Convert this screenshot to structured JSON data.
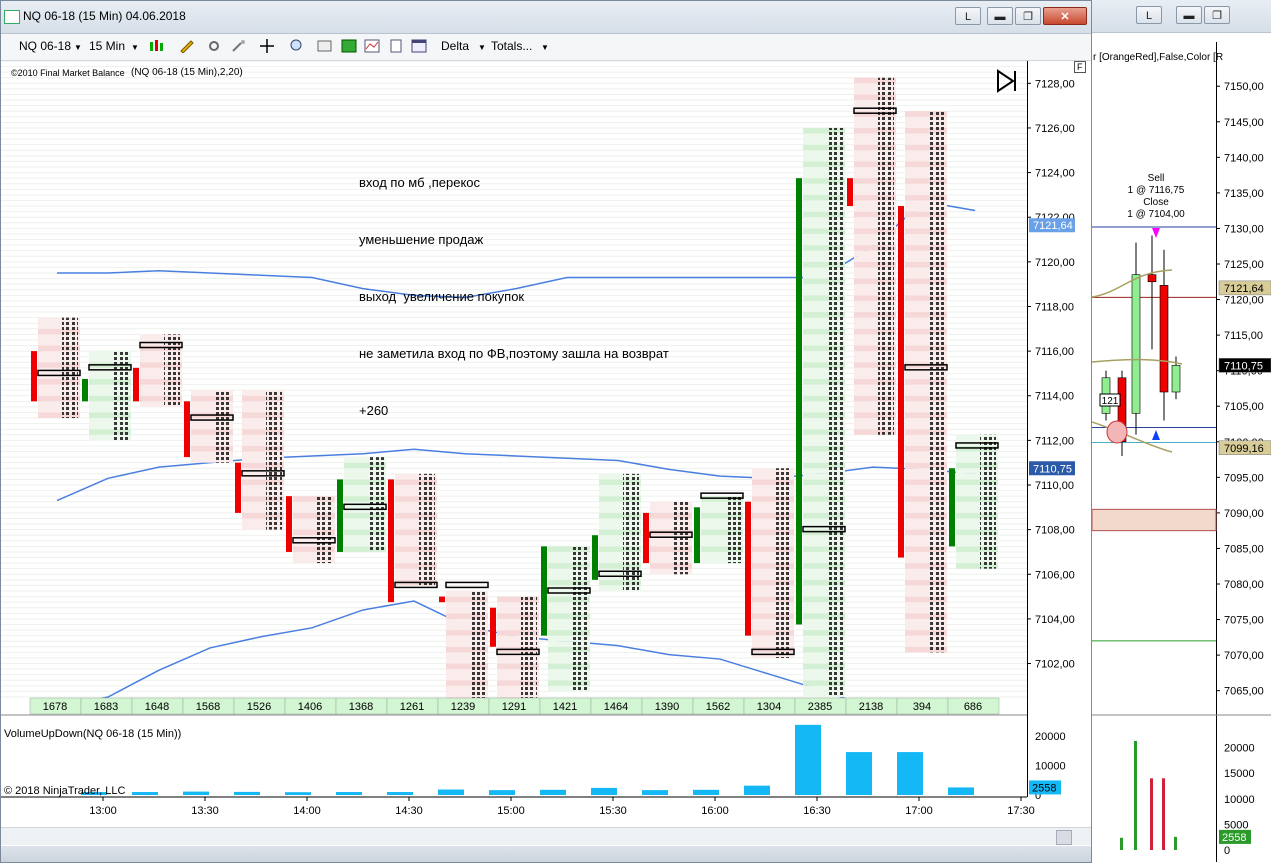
{
  "window": {
    "title": "NQ 06-18 (15 Min)  04.06.2018",
    "buttons": [
      "L",
      "▬",
      "❐",
      "✕"
    ]
  },
  "toolbar": {
    "instrument": "NQ 06-18",
    "interval": "15 Min",
    "indicator_dropdown_1": "Delta",
    "indicator_dropdown_2": "Totals..."
  },
  "indicator_label": "©2010 Final Market Balance",
  "indicator_params": "(NQ 06-18 (15 Min),2,20)",
  "annotation_lines": [
    "вход по мб ,перекос",
    "уменьшение продаж",
    "выход  увеличение покупок",
    "не заметила вход по ФВ,поэтому зашла на возврат",
    "+260"
  ],
  "panel_flag": "F",
  "sub_panel_label": "VolumeUpDown(NQ 06-18 (15 Min))",
  "copyright": "© 2018 NinjaTrader, LLC",
  "colors": {
    "up": "#008000",
    "down": "#ee0000",
    "band": "#4a7fe0",
    "volume": "#14b8f5",
    "price_tag": "#4a86d8"
  },
  "chart_data": [
    {
      "type": "candlestick",
      "title": "NQ 06-18 (15 Min)",
      "time_labels": [
        "13:00",
        "13:30",
        "14:00",
        "14:30",
        "15:00",
        "15:30",
        "16:00",
        "16:30",
        "17:00",
        "17:30"
      ],
      "y_ticks": [
        "7128,00",
        "7126,00",
        "7124,00",
        "7122,00",
        "7120,00",
        "7118,00",
        "7116,00",
        "7114,00",
        "7112,00",
        "7110,00",
        "7108,00",
        "7106,00",
        "7104,00",
        "7102,00"
      ],
      "ylim": [
        7100.5,
        7129.0
      ],
      "current_price": "7110,75",
      "price_tags": [
        "7121,64",
        "7110,75"
      ],
      "bars": [
        {
          "time": "12:45",
          "open": 7116.0,
          "close": 7113.75,
          "low": 7113.0,
          "high": 7117.5,
          "poc": 7115.0,
          "total": "1678"
        },
        {
          "time": "13:00",
          "open": 7113.75,
          "close": 7114.75,
          "low": 7112.0,
          "high": 7116.0,
          "poc": 7115.25,
          "total": "1683"
        },
        {
          "time": "13:15",
          "open": 7115.25,
          "close": 7113.75,
          "low": 7113.5,
          "high": 7116.75,
          "poc": 7116.25,
          "total": "1648"
        },
        {
          "time": "13:30",
          "open": 7113.75,
          "close": 7111.25,
          "low": 7111.0,
          "high": 7114.25,
          "poc": 7113.0,
          "total": "1568"
        },
        {
          "time": "13:45",
          "open": 7111.0,
          "close": 7108.75,
          "low": 7108.0,
          "high": 7114.25,
          "poc": 7110.5,
          "total": "1526"
        },
        {
          "time": "14:00",
          "open": 7109.5,
          "close": 7107.0,
          "low": 7106.5,
          "high": 7109.5,
          "poc": 7107.5,
          "total": "1406"
        },
        {
          "time": "14:15",
          "open": 7107.0,
          "close": 7110.25,
          "low": 7107.0,
          "high": 7111.25,
          "poc": 7109.0,
          "total": "1368"
        },
        {
          "time": "14:30",
          "open": 7110.25,
          "close": 7104.75,
          "low": 7105.5,
          "high": 7110.5,
          "poc": 7105.5,
          "total": "1261"
        },
        {
          "time": "14:45",
          "open": 7105.0,
          "close": 7104.75,
          "low": 7100.25,
          "high": 7105.25,
          "poc": 7105.5,
          "total": "1239"
        },
        {
          "time": "15:00",
          "open": 7104.5,
          "close": 7102.75,
          "low": 7100.25,
          "high": 7105.0,
          "poc": 7102.5,
          "total": "1291"
        },
        {
          "time": "15:15",
          "open": 7103.25,
          "close": 7107.25,
          "low": 7100.75,
          "high": 7107.25,
          "poc": 7105.25,
          "total": "1421"
        },
        {
          "time": "15:30",
          "open": 7105.75,
          "close": 7107.75,
          "low": 7105.25,
          "high": 7110.5,
          "poc": 7106.0,
          "total": "1464"
        },
        {
          "time": "15:45",
          "open": 7108.75,
          "close": 7106.5,
          "low": 7106.0,
          "high": 7109.25,
          "poc": 7107.75,
          "total": "1390"
        },
        {
          "time": "16:00",
          "open": 7106.5,
          "close": 7109.0,
          "low": 7106.5,
          "high": 7109.5,
          "poc": 7109.5,
          "total": "1562"
        },
        {
          "time": "16:15",
          "open": 7109.25,
          "close": 7103.25,
          "low": 7102.25,
          "high": 7110.75,
          "poc": 7102.5,
          "total": "1304"
        },
        {
          "time": "16:30",
          "open": 7103.75,
          "close": 7123.75,
          "low": 7100.5,
          "high": 7126.0,
          "poc": 7108.0,
          "total": "2385"
        },
        {
          "time": "16:45",
          "open": 7123.75,
          "close": 7122.5,
          "low": 7112.25,
          "high": 7128.25,
          "poc": 7126.75,
          "total": "2138"
        },
        {
          "time": "17:00",
          "open": 7122.5,
          "close": 7106.75,
          "low": 7102.5,
          "high": 7126.75,
          "poc": 7115.25,
          "total": "394"
        },
        {
          "time": "17:15",
          "open": 7107.25,
          "close": 7110.75,
          "low": 7106.25,
          "high": 7112.25,
          "poc": 7111.75,
          "total": "686"
        }
      ],
      "upper_band": [
        7119.5,
        7119.5,
        7119.6,
        7119.5,
        7119.4,
        7119.3,
        7118.8,
        7118.5,
        7118.4,
        7118.8,
        7119.3,
        7119.3,
        7119.3,
        7119.3,
        7119.3,
        7119.3,
        7120.7,
        7122.7,
        7122.3
      ],
      "lower_band": [
        7109.3,
        7110.3,
        7110.8,
        7111.0,
        7111.2,
        7111.3,
        7111.4,
        7111.6,
        7111.4,
        7111.3,
        7111.2,
        7111.1,
        7110.7,
        7110.4,
        7110.3,
        7110.5,
        7110.8,
        7110.7,
        7110.5
      ],
      "lower_band2": [
        7100.0,
        7100.5,
        7101.7,
        7102.7,
        7103.2,
        7103.6,
        7104.4,
        7104.8,
        7103.7,
        7103.2,
        7103.0,
        7102.8,
        7102.4,
        7102.2,
        7101.5,
        7100.8,
        7100.0,
        7100.0,
        7100.0
      ]
    },
    {
      "type": "bar",
      "title": "VolumeUpDown(NQ 06-18 (15 Min))",
      "y_ticks": [
        "20000",
        "10000",
        "0"
      ],
      "ylim": [
        0,
        25000
      ],
      "last_value": "2558",
      "values": [
        1000,
        1000,
        1150,
        1050,
        950,
        1000,
        1000,
        1850,
        1650,
        1750,
        2400,
        1650,
        1750,
        3150,
        23700,
        14500,
        14500,
        2558
      ]
    },
    {
      "type": "candlestick",
      "title": "right chart",
      "y_ticks": [
        "7150,00",
        "7145,00",
        "7140,00",
        "7135,00",
        "7130,00",
        "7125,00",
        "7120,00",
        "7115,00",
        "7110,00",
        "7105,00",
        "7100,00",
        "7095,00",
        "7090,00",
        "7085,00",
        "7080,00",
        "7075,00",
        "7070,00",
        "7065,00"
      ],
      "ylim": [
        7062.0,
        7152.0
      ],
      "price_tags": [
        "7121,64",
        "7110,75",
        "7099,16"
      ],
      "header_text": "r [OrangeRed],False,Color [R",
      "trade_labels": [
        "Sell",
        "1 @ 7116,75",
        "Close",
        "1 @ 7104,00"
      ],
      "box_label": "121",
      "bars": [
        {
          "open": 7104.0,
          "close": 7109.0,
          "low": 7103.0,
          "high": 7110.0
        },
        {
          "open": 7109.0,
          "close": 7100.0,
          "low": 7098.0,
          "high": 7110.0
        },
        {
          "open": 7104.0,
          "close": 7123.5,
          "low": 7101.0,
          "high": 7128.0
        },
        {
          "open": 7123.5,
          "close": 7122.5,
          "low": 7113.0,
          "high": 7129.0
        },
        {
          "open": 7122.0,
          "close": 7107.0,
          "low": 7103.0,
          "high": 7127.0
        },
        {
          "open": 7107.0,
          "close": 7110.75,
          "low": 7106.0,
          "high": 7112.0
        }
      ],
      "volume_ticks": [
        "20000",
        "15000",
        "10000",
        "5000",
        "0"
      ],
      "volume_last": "2558",
      "volumes": [
        {
          "value": 2385,
          "dir": "up"
        },
        {
          "value": 21300,
          "dir": "up"
        },
        {
          "value": 14000,
          "dir": "down"
        },
        {
          "value": 14000,
          "dir": "down"
        },
        {
          "value": 2558,
          "dir": "up"
        }
      ]
    }
  ]
}
